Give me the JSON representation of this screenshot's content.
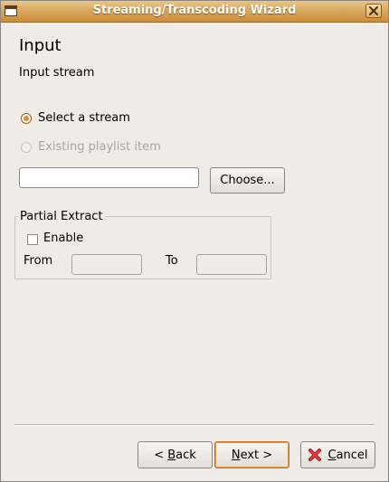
{
  "window": {
    "title": "Streaming/Transcoding Wizard"
  },
  "page": {
    "heading": "Input",
    "subheading": "Input stream"
  },
  "input_mode": {
    "options": [
      {
        "label": "Select a stream",
        "selected": true,
        "enabled": true
      },
      {
        "label": "Existing playlist item",
        "selected": false,
        "enabled": false
      }
    ]
  },
  "stream": {
    "value": "",
    "choose_label": "Choose..."
  },
  "partial_extract": {
    "legend": "Partial Extract",
    "enable_label": "Enable",
    "enable_checked": false,
    "from_label": "From",
    "to_label": "To",
    "from_value": "",
    "to_value": ""
  },
  "buttons": {
    "back_prefix": "< ",
    "back_mnemonic": "B",
    "back_rest": "ack",
    "next_mnemonic": "N",
    "next_rest": "ext >",
    "cancel_mnemonic": "C",
    "cancel_rest": "ancel",
    "cancel_icon": "cancel-x-icon"
  },
  "colors": {
    "titlebar": "#d9a95d",
    "accent": "#e2893b",
    "cancel_icon": "#d32b2b",
    "background": "#efebe7"
  }
}
